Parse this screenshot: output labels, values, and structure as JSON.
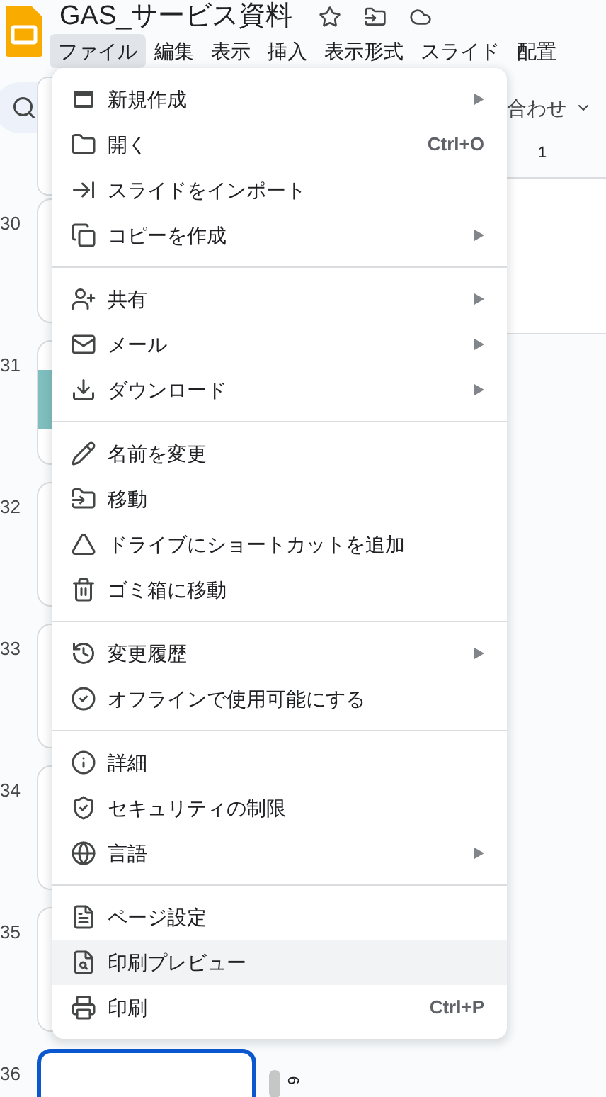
{
  "header": {
    "title": "GAS_サービス資料"
  },
  "menubar": [
    {
      "label": "ファイル",
      "selected": true
    },
    {
      "label": "編集",
      "selected": false
    },
    {
      "label": "表示",
      "selected": false
    },
    {
      "label": "挿入",
      "selected": false
    },
    {
      "label": "表示形式",
      "selected": false
    },
    {
      "label": "スライド",
      "selected": false
    },
    {
      "label": "配置",
      "selected": false
    }
  ],
  "toolbar": {
    "zoom_button": "合わせ"
  },
  "ruler": {
    "top_label": "1",
    "side_label": "6"
  },
  "filmstrip": [
    {
      "number": "30",
      "selected": false
    },
    {
      "number": "31",
      "selected": false
    },
    {
      "number": "32",
      "selected": false
    },
    {
      "number": "33",
      "selected": false
    },
    {
      "number": "34",
      "selected": false
    },
    {
      "number": "35",
      "selected": false
    },
    {
      "number": "36",
      "selected": true
    }
  ],
  "menu": {
    "sections": [
      {
        "items": [
          {
            "label": "新規作成",
            "submenu": true,
            "highlighted": false
          },
          {
            "label": "開く",
            "shortcut": "Ctrl+O",
            "submenu": false,
            "highlighted": false
          },
          {
            "label": "スライドをインポート",
            "submenu": false,
            "highlighted": false
          },
          {
            "label": "コピーを作成",
            "submenu": true,
            "highlighted": false
          }
        ]
      },
      {
        "items": [
          {
            "label": "共有",
            "submenu": true,
            "highlighted": false
          },
          {
            "label": "メール",
            "submenu": true,
            "highlighted": false
          },
          {
            "label": "ダウンロード",
            "submenu": true,
            "highlighted": false
          }
        ]
      },
      {
        "items": [
          {
            "label": "名前を変更",
            "submenu": false,
            "highlighted": false
          },
          {
            "label": "移動",
            "submenu": false,
            "highlighted": false
          },
          {
            "label": "ドライブにショートカットを追加",
            "submenu": false,
            "highlighted": false
          },
          {
            "label": "ゴミ箱に移動",
            "submenu": false,
            "highlighted": false
          }
        ]
      },
      {
        "items": [
          {
            "label": "変更履歴",
            "submenu": true,
            "highlighted": false
          },
          {
            "label": "オフラインで使用可能にする",
            "submenu": false,
            "highlighted": false
          }
        ]
      },
      {
        "items": [
          {
            "label": "詳細",
            "submenu": false,
            "highlighted": false
          },
          {
            "label": "セキュリティの制限",
            "submenu": false,
            "highlighted": false
          },
          {
            "label": "言語",
            "submenu": true,
            "highlighted": false
          }
        ]
      },
      {
        "items": [
          {
            "label": "ページ設定",
            "submenu": false,
            "highlighted": false
          },
          {
            "label": "印刷プレビュー",
            "submenu": false,
            "highlighted": true
          },
          {
            "label": "印刷",
            "shortcut": "Ctrl+P",
            "submenu": false,
            "highlighted": false
          }
        ]
      }
    ]
  }
}
